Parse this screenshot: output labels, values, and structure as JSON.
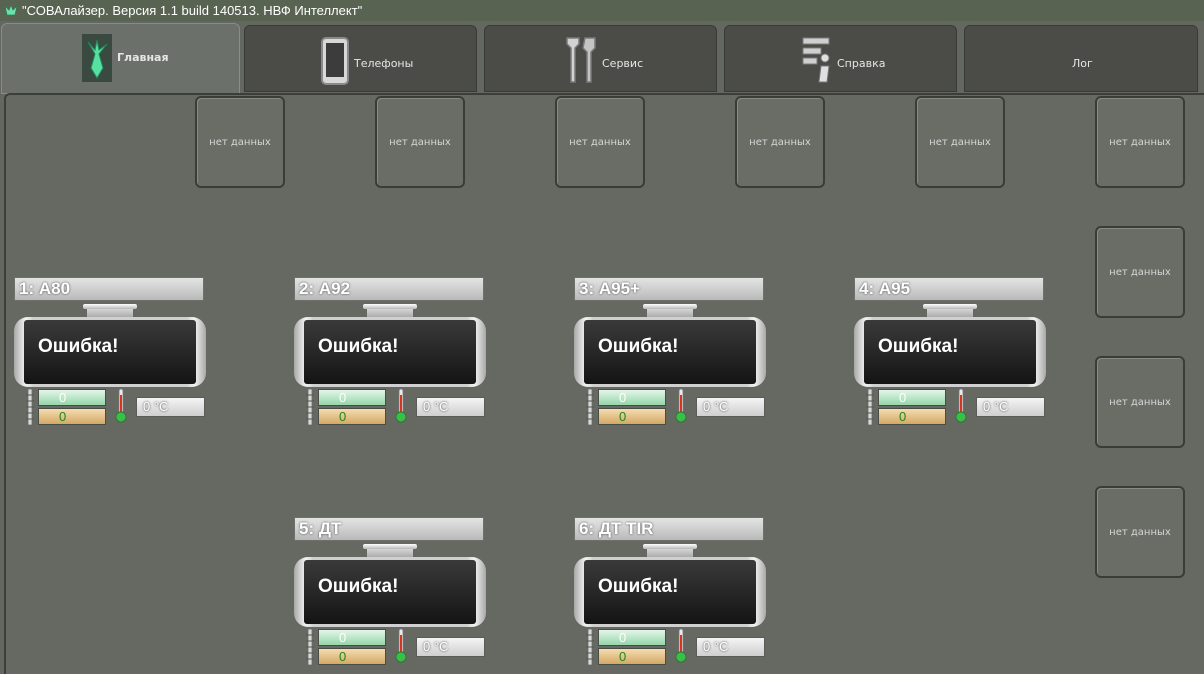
{
  "window": {
    "title": "\"СОВАлайзер. Версия 1.1 build 140513. НВФ Интеллект\""
  },
  "tabs": [
    {
      "label": "Главная",
      "icon": "owl-icon",
      "active": true
    },
    {
      "label": "Телефоны",
      "icon": "phone-icon",
      "active": false
    },
    {
      "label": "Сервис",
      "icon": "tools-icon",
      "active": false
    },
    {
      "label": "Справка",
      "icon": "help-icon",
      "active": false
    },
    {
      "label": "Лог",
      "icon": "",
      "active": false
    }
  ],
  "nozzles": [
    "нет данных",
    "нет данных",
    "нет данных",
    "нет данных",
    "нет данных",
    "нет данных",
    "нет данных",
    "нет данных",
    "нет данных"
  ],
  "tanks": [
    {
      "name": "1: А80",
      "status": "Ошибка!",
      "level_top": "0",
      "level_bottom": "0",
      "temperature": "0 °C"
    },
    {
      "name": "2: А92",
      "status": "Ошибка!",
      "level_top": "0",
      "level_bottom": "0",
      "temperature": "0 °C"
    },
    {
      "name": "3: А95+",
      "status": "Ошибка!",
      "level_top": "0",
      "level_bottom": "0",
      "temperature": "0 °C"
    },
    {
      "name": "4: А95",
      "status": "Ошибка!",
      "level_top": "0",
      "level_bottom": "0",
      "temperature": "0 °C"
    },
    {
      "name": "5: ДТ",
      "status": "Ошибка!",
      "level_top": "0",
      "level_bottom": "0",
      "temperature": "0 °C"
    },
    {
      "name": "6: ДТ TIR",
      "status": "Ошибка!",
      "level_top": "0",
      "level_bottom": "0",
      "temperature": "0 °C"
    }
  ],
  "colors": {
    "background": "#666962",
    "titlebar": "#586352",
    "accent_green": "#5fd39a"
  }
}
